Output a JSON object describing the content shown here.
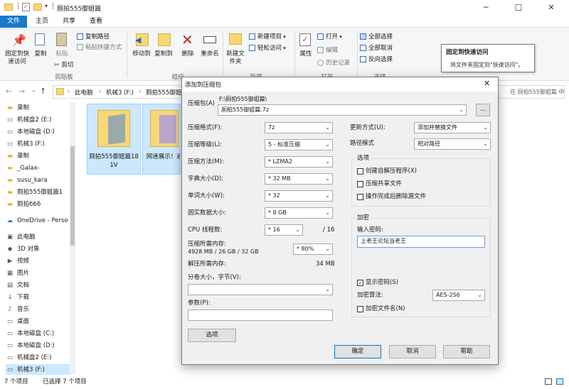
{
  "window": {
    "title": "厕拍555御姐篇",
    "controls": [
      "─",
      "☐",
      "✕"
    ]
  },
  "tabs": [
    {
      "label": "文件"
    },
    {
      "label": "主页"
    },
    {
      "label": "共享"
    },
    {
      "label": "查看"
    }
  ],
  "ribbon": {
    "pin_quick_access": "固定到快速访问",
    "copy": "复制",
    "paste": "粘贴",
    "copy_path": "复制路径",
    "paste_shortcut": "粘贴快捷方式",
    "cut": "剪切",
    "clipboard_group": "剪贴板",
    "move_to": "移动到",
    "copy_to": "复制到",
    "delete": "删除",
    "rename": "重命名",
    "organize_group": "组织",
    "new_folder": "新建文件夹",
    "new_item": "新建项目",
    "easy_access": "轻松访问",
    "new_group": "新建",
    "properties": "属性",
    "open": "打开",
    "edit": "编辑",
    "history": "历史记录",
    "open_group": "打开",
    "select_all": "全部选择",
    "select_none": "全部取消",
    "invert_selection": "反向选择",
    "select_group": "选择"
  },
  "tooltip": {
    "title": "固定到快速访问",
    "body": "将文件夹固定到\"快速访问\"。"
  },
  "address": {
    "crumbs": [
      "此电脑",
      "机械3 (F:)",
      "厕拍555御姐篇"
    ],
    "search_placeholder": "在 厕拍555御姐篇 中搜索"
  },
  "nav": [
    {
      "label": "录制",
      "icon": "folder-icon"
    },
    {
      "label": "机械盘2 (E:)",
      "icon": "drive-icon"
    },
    {
      "label": "本地磁盘 (D:)",
      "icon": "drive-icon"
    },
    {
      "label": "机械3 (F:)",
      "icon": "drive-icon"
    },
    {
      "label": "录制",
      "icon": "folder-icon"
    },
    {
      "label": "_Galax-",
      "icon": "folder-icon"
    },
    {
      "label": "susu_kara",
      "icon": "folder-icon"
    },
    {
      "label": "厕拍555御姐篇1",
      "icon": "folder-icon"
    },
    {
      "label": "厕拍666",
      "icon": "folder-icon"
    },
    {
      "label": "OneDrive - Perso",
      "icon": "cloud-icon"
    },
    {
      "label": "此电脑",
      "icon": "computer-icon"
    },
    {
      "label": "3D 对象",
      "icon": "cube-icon"
    },
    {
      "label": "视频",
      "icon": "video-icon"
    },
    {
      "label": "图片",
      "icon": "picture-icon"
    },
    {
      "label": "文档",
      "icon": "document-icon"
    },
    {
      "label": "下载",
      "icon": "download-icon"
    },
    {
      "label": "音乐",
      "icon": "music-icon"
    },
    {
      "label": "桌面",
      "icon": "desktop-icon"
    },
    {
      "label": "本地磁盘 (C:)",
      "icon": "drive-icon"
    },
    {
      "label": "本地磁盘 (D:)",
      "icon": "drive-icon"
    },
    {
      "label": "机械盘2 (E:)",
      "icon": "drive-icon"
    },
    {
      "label": "机械3 (F:)",
      "icon": "drive-icon"
    }
  ],
  "files": [
    {
      "name": "厕拍555御姐篇181V"
    },
    {
      "name": "网速展示！通!"
    }
  ],
  "status": {
    "count": "7 个项目",
    "selected": "已选择 7 个项目"
  },
  "dialog": {
    "title": "添加到压缩包",
    "archive_label": "压缩包(A)",
    "archive_dir": "F:\\厕拍555御姐篇\\",
    "archive_name": "厕拍555御姐篇.7z",
    "browse": "...",
    "format_label": "压缩格式(F):",
    "format_value": "7z",
    "level_label": "压缩等级(L):",
    "level_value": "5 - 标准压缩",
    "method_label": "压缩方法(M):",
    "method_value": "* LZMA2",
    "dict_label": "字典大小(D):",
    "dict_value": "* 32 MB",
    "word_label": "单词大小(W):",
    "word_value": "* 32",
    "solid_label": "固实数据大小:",
    "solid_value": "* 8 GB",
    "threads_label": "CPU 线程数:",
    "threads_value": "* 16",
    "threads_total": "/ 16",
    "mem_comp_label": "压缩所需内存:",
    "mem_comp_detail": "4928 MB / 26 GB / 32 GB",
    "mem_comp_value": "* 80%",
    "mem_decomp_label": "解压所需内存:",
    "mem_decomp_value": "34 MB",
    "split_label": "分卷大小，字节(V):",
    "split_value": "",
    "params_label": "参数(P):",
    "params_value": "",
    "options_button": "选项",
    "update_label": "更新方式(U):",
    "update_value": "添加并替换文件",
    "path_label": "路径模式",
    "path_value": "相对路径",
    "options_group": "选项",
    "opt_sfx": "创建自解压程序(X)",
    "opt_shared": "压缩共享文件",
    "opt_delete": "操作完成后删除源文件",
    "encrypt_group": "加密",
    "password_label": "输入密码:",
    "password_value": "上老王论坛当老王",
    "show_password": "显示密码(S)",
    "enc_method_label": "加密算法:",
    "enc_method_value": "AES-256",
    "encrypt_names": "加密文件名(N)",
    "ok": "确定",
    "cancel": "取消",
    "help": "帮助"
  },
  "colors": {
    "accent": "#1979ca",
    "folder": "#f8d775",
    "selection": "#cce8ff"
  }
}
